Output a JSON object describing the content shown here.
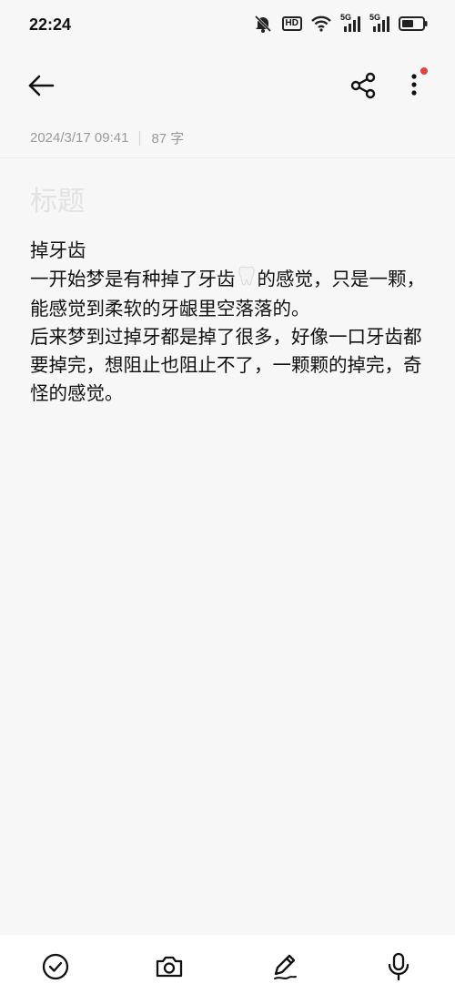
{
  "status_bar": {
    "time": "22:24",
    "hd_label": "HD",
    "signal_label_1": "5G",
    "signal_label_2": "5G"
  },
  "toolbar": {
    "back_icon": "arrow-left-icon",
    "share_icon": "share-icon",
    "more_icon": "more-vertical-icon",
    "badge_color": "#e0443a"
  },
  "meta": {
    "datetime": "2024/3/17 09:41",
    "word_count": "87 字"
  },
  "note": {
    "title_placeholder": "标题",
    "line1": "掉牙齿",
    "para2_before": "一开始梦是有种掉了牙齿",
    "para2_after": "的感觉，只是一颗，能感觉到柔软的牙龈里空落落的。",
    "para3": "后来梦到过掉牙都是掉了很多，好像一口牙齿都要掉完，想阻止也阻止不了，一颗颗的掉完，奇怪的感觉。"
  },
  "bottom_bar": {
    "items": [
      "checklist-icon",
      "camera-icon",
      "pen-icon",
      "microphone-icon"
    ]
  }
}
